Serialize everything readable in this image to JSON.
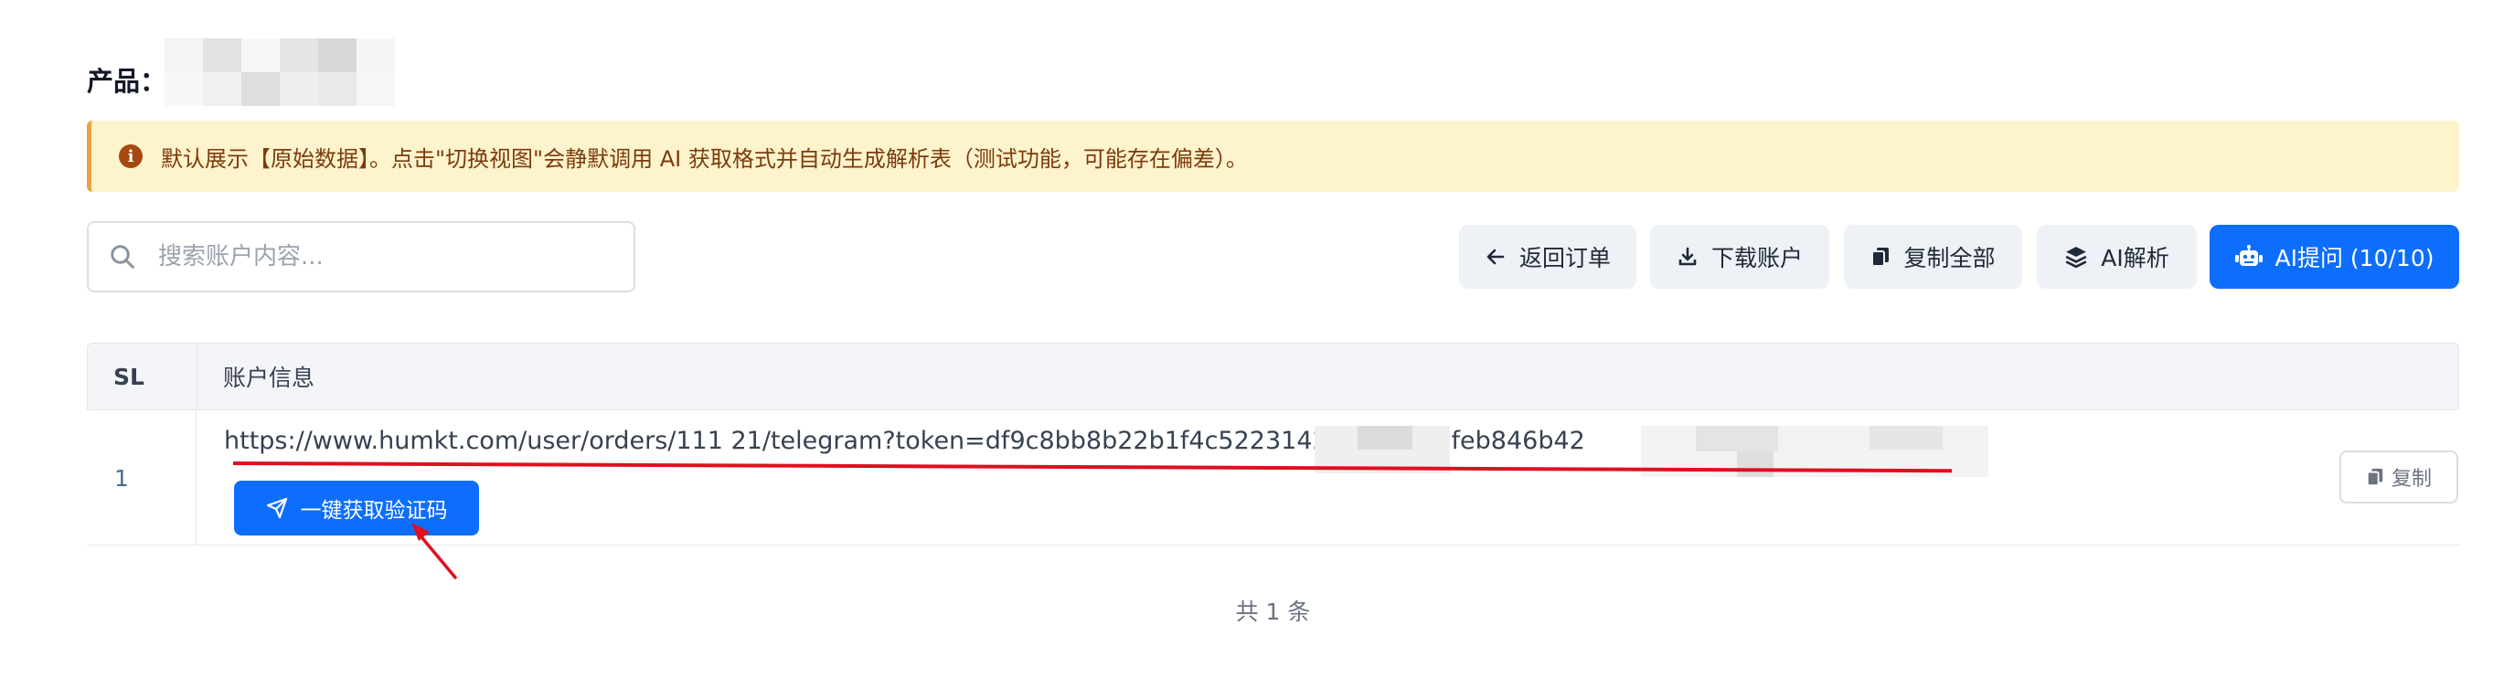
{
  "product": {
    "label": "产品："
  },
  "alert": {
    "icon": "info-icon",
    "text": "默认展示【原始数据】。点击\"切换视图\"会静默调用 AI 获取格式并自动生成解析表（测试功能，可能存在偏差）。"
  },
  "search": {
    "placeholder": "搜索账户内容..."
  },
  "toolbar": {
    "back_label": "返回订单",
    "download_label": "下载账户",
    "copy_all_label": "复制全部",
    "ai_parse_label": "AI解析",
    "ai_ask_label": "AI提问 (10/10)"
  },
  "table": {
    "headers": {
      "sl": "SL",
      "info": "账户信息"
    },
    "rows": [
      {
        "sl": "1",
        "url": "https://www.humkt.com/user/orders/111   21/telegram?token=df9c8bb8b22b1f4c52231424c        9fee61feb846b42",
        "verify_label": "一键获取验证码",
        "copy_label": "复制"
      }
    ]
  },
  "footer": {
    "total": "共 1 条"
  },
  "colors": {
    "primary": "#0d6efd",
    "alert_bg": "#fdf3cc",
    "alert_text": "#7c3b0c",
    "annotation_red": "#e10f1f"
  }
}
